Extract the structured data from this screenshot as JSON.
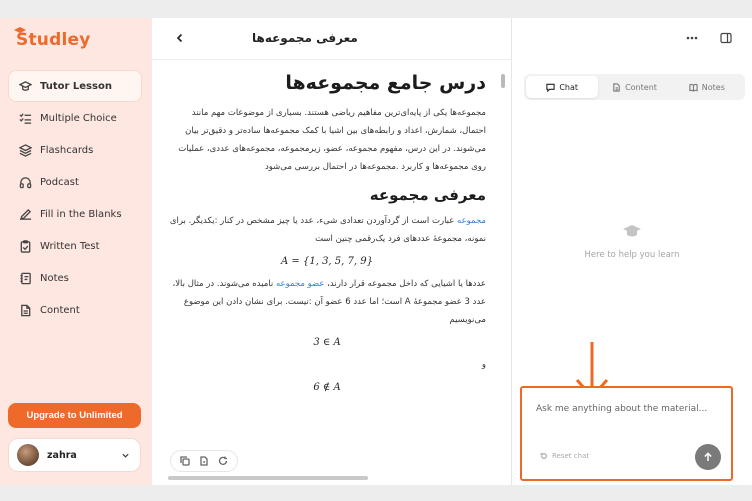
{
  "app": {
    "logo": "Studley"
  },
  "sidebar": {
    "items": [
      {
        "label": "Tutor Lesson",
        "icon": "graduation-cap-icon",
        "active": true
      },
      {
        "label": "Multiple Choice",
        "icon": "checklist-icon"
      },
      {
        "label": "Flashcards",
        "icon": "layers-icon"
      },
      {
        "label": "Podcast",
        "icon": "headphones-icon"
      },
      {
        "label": "Fill in the Blanks",
        "icon": "pencil-icon"
      },
      {
        "label": "Written Test",
        "icon": "clipboard-check-icon"
      },
      {
        "label": "Notes",
        "icon": "notebook-icon"
      },
      {
        "label": "Content",
        "icon": "document-icon"
      }
    ],
    "upgrade_label": "Upgrade to Unlimited",
    "user_name": "zahra"
  },
  "header": {
    "title": "معرفی مجموعه‌ها"
  },
  "document": {
    "h1": "درس جامع مجموعه‌ها",
    "p1": "مجموعه‌ها یکی از پایه‌ای‌ترین مفاهیم ریاضی هستند. بسیاری از موضوعات مهم مانند احتمال، شمارش، اعداد و رابطه‌های بین اشیا با کمک مجموعه‌ها ساده‌تر و دقیق‌تر بیان می‌شوند. در این درس، مفهوم مجموعه، عضو، زیرمجموعه، مجموعه‌های عددی، عملیات روی مجموعه‌ها و کاربرد .مجموعه‌ها در احتمال بررسی می‌شود",
    "h2": "معرفی مجموعه",
    "p2_link": "مجموعه",
    "p2_rest": " عبارت است از گردآوردن تعدادی شیء، عدد یا چیز مشخص در کنار :یکدیگر. برای نمونه، مجموعهٔ عددهای فرد یک‌رقمی چنین است",
    "math1": "A = {1, 3, 5, 7, 9}",
    "p3_a": "عددها یا اشیایی که داخل مجموعه قرار دارند، ",
    "p3_link": "عضو مجموعه",
    "p3_b": " نامیده می‌شوند. در مثال بالا، عدد 3 عضو مجموعهٔ A است؛ اما عدد 6 عضو آن :نیست. برای نشان دادن این موضوع می‌نویسیم",
    "math2": "3 ∈ A",
    "and": "و",
    "math3": "6 ∉ A"
  },
  "right_panel": {
    "tabs": [
      {
        "label": "Chat",
        "icon": "chat-icon",
        "active": true
      },
      {
        "label": "Content",
        "icon": "document-icon"
      },
      {
        "label": "Notes",
        "icon": "book-icon"
      }
    ],
    "empty_text": "Here to help you learn",
    "input_placeholder": "Ask me anything about the material...",
    "reset_label": "Reset chat"
  },
  "colors": {
    "brand": "#ec6a2c",
    "sidebar_bg": "#fde7e0",
    "link": "#2f7ddf",
    "annotation": "#ec6a25"
  }
}
